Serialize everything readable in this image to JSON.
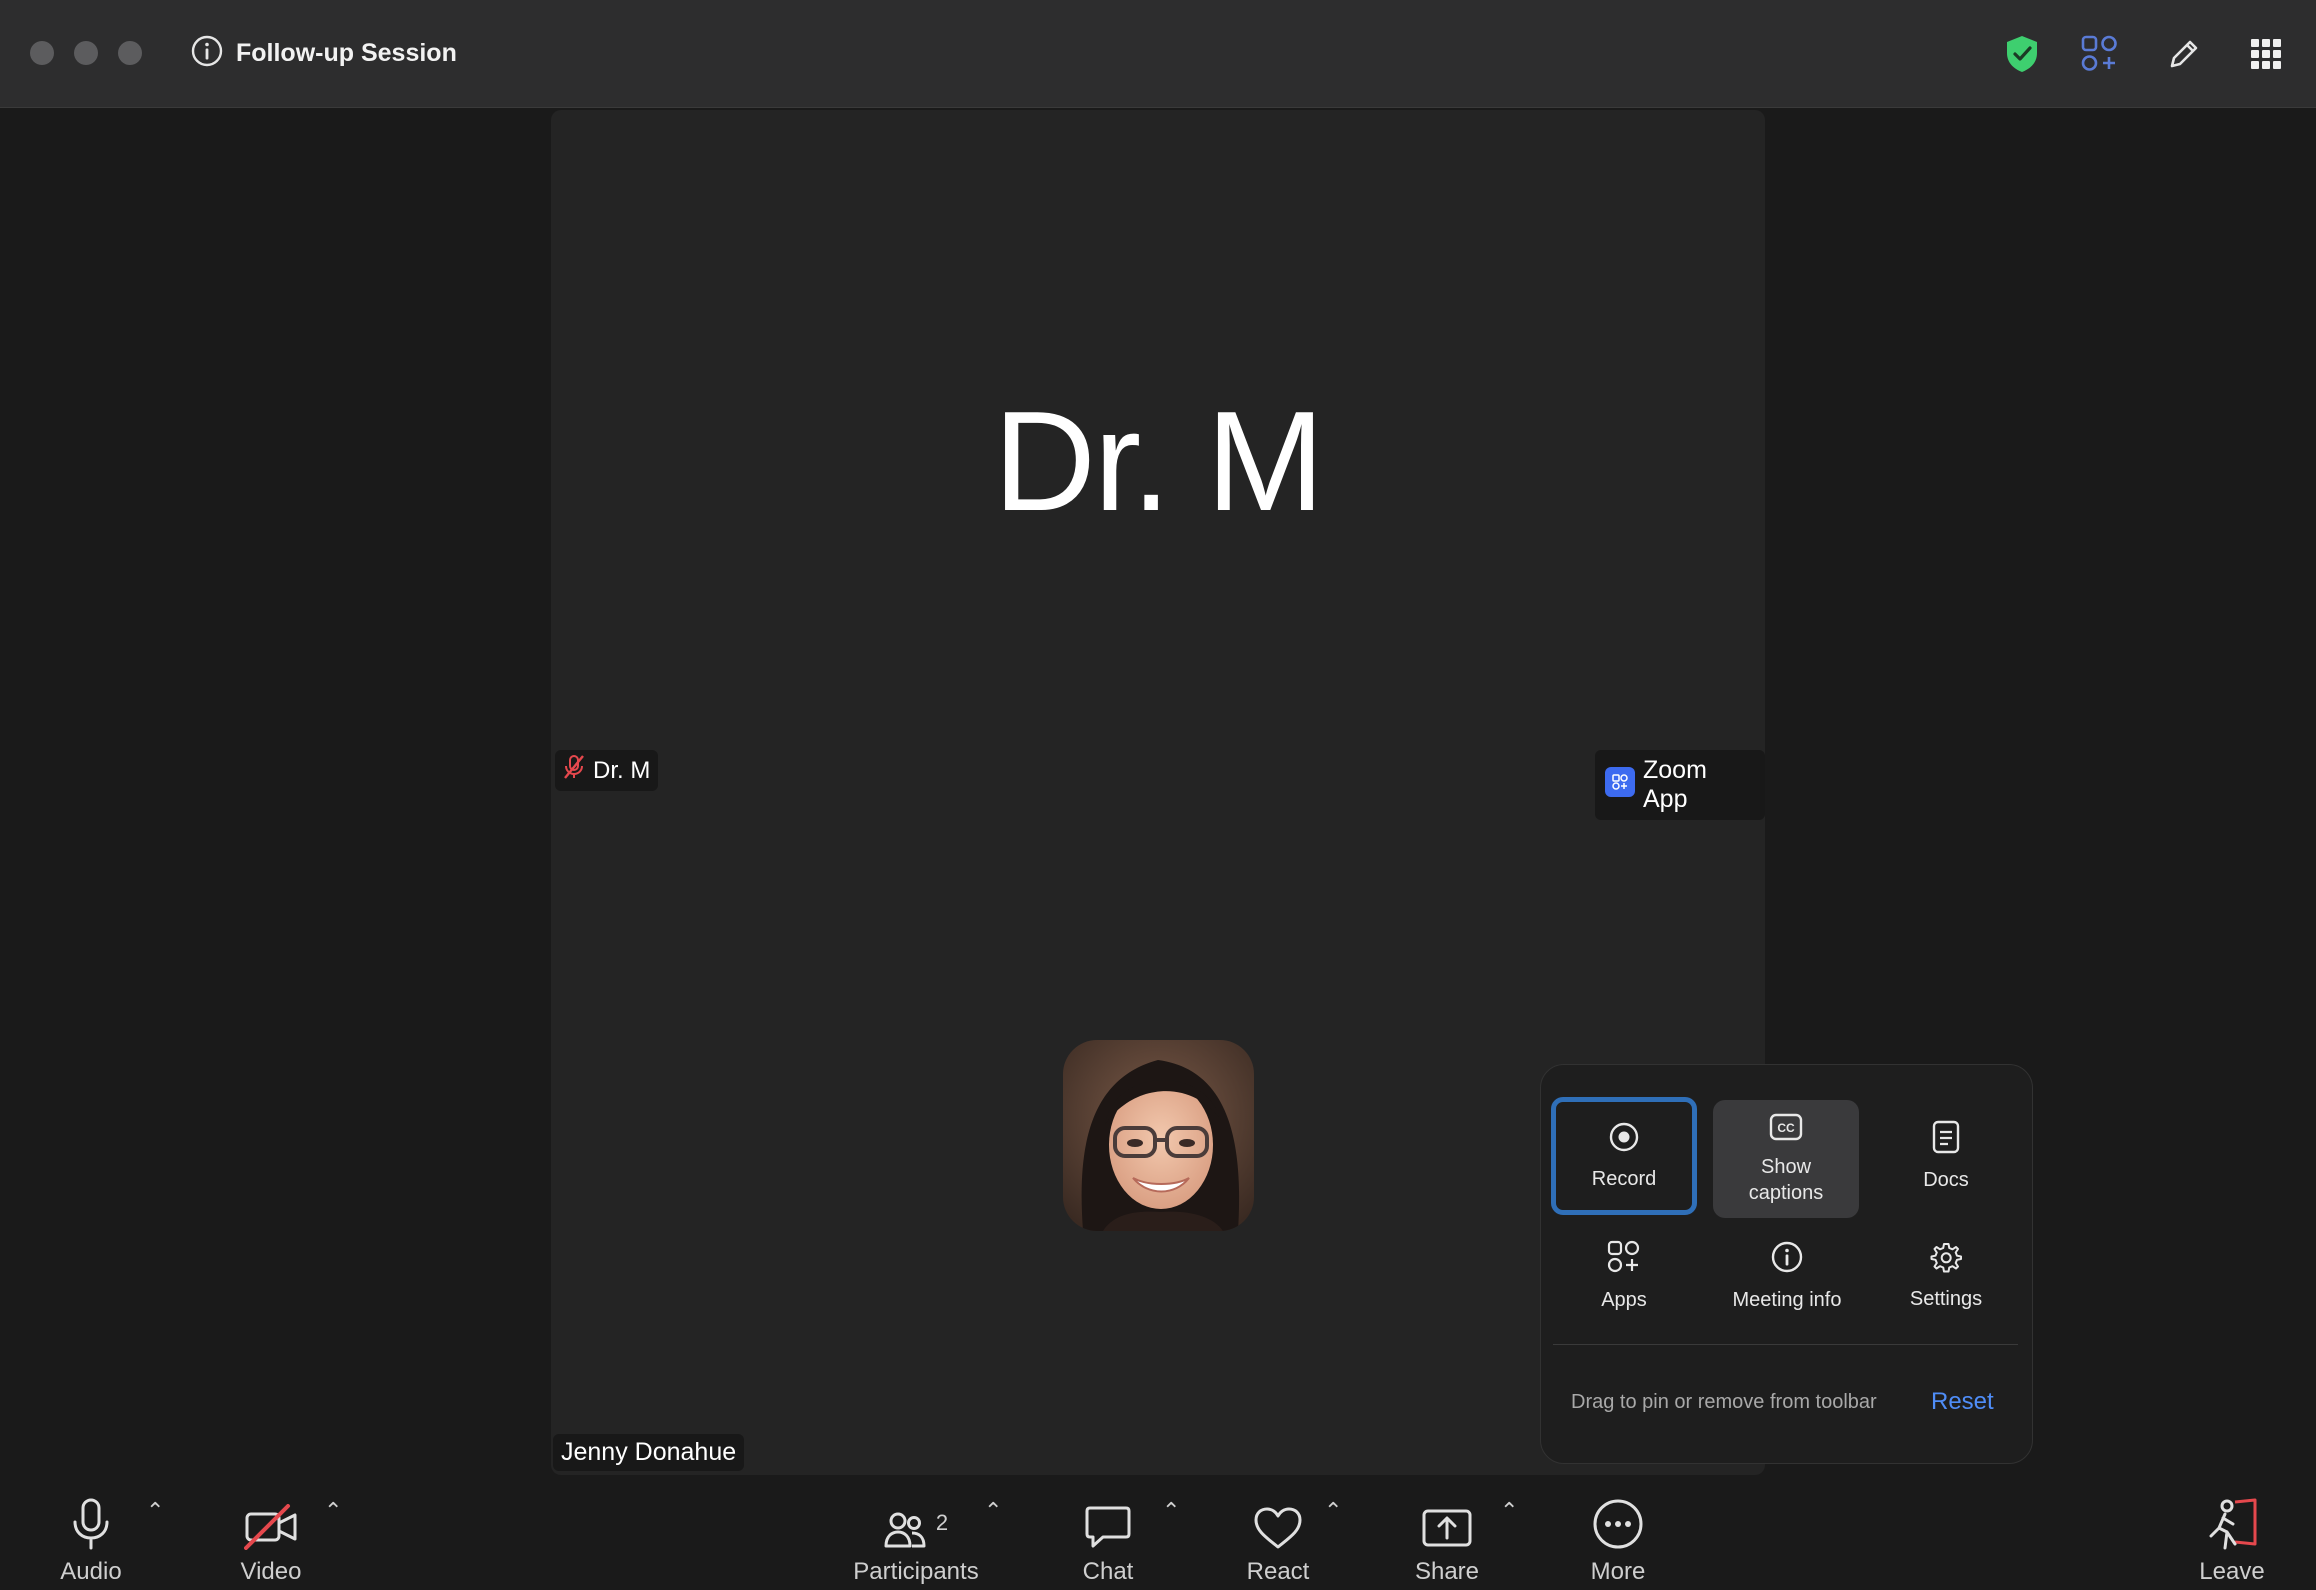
{
  "window": {
    "title": "Follow-up Session"
  },
  "tile": {
    "big_name": "Dr. M",
    "speaker_label": "Dr. M",
    "app_badge": "Zoom App",
    "self_label": "Jenny Donahue"
  },
  "more_menu": {
    "items": [
      {
        "label": "Record",
        "icon": "record-icon"
      },
      {
        "label": "Show captions",
        "icon": "cc-icon"
      },
      {
        "label": "Docs",
        "icon": "docs-icon"
      },
      {
        "label": "Apps",
        "icon": "apps-icon"
      },
      {
        "label": "Meeting info",
        "icon": "info-icon"
      },
      {
        "label": "Settings",
        "icon": "gear-icon"
      }
    ],
    "hint": "Drag to pin or remove from toolbar",
    "reset": "Reset"
  },
  "toolbar": {
    "audio": "Audio",
    "video": "Video",
    "participants": "Participants",
    "participants_count": "2",
    "chat": "Chat",
    "react": "React",
    "share": "Share",
    "more": "More",
    "leave": "Leave"
  },
  "colors": {
    "accent": "#4f8df7",
    "shield": "#3ecf6f",
    "leave": "#e5484d",
    "record_outline": "#2f6fb8"
  }
}
